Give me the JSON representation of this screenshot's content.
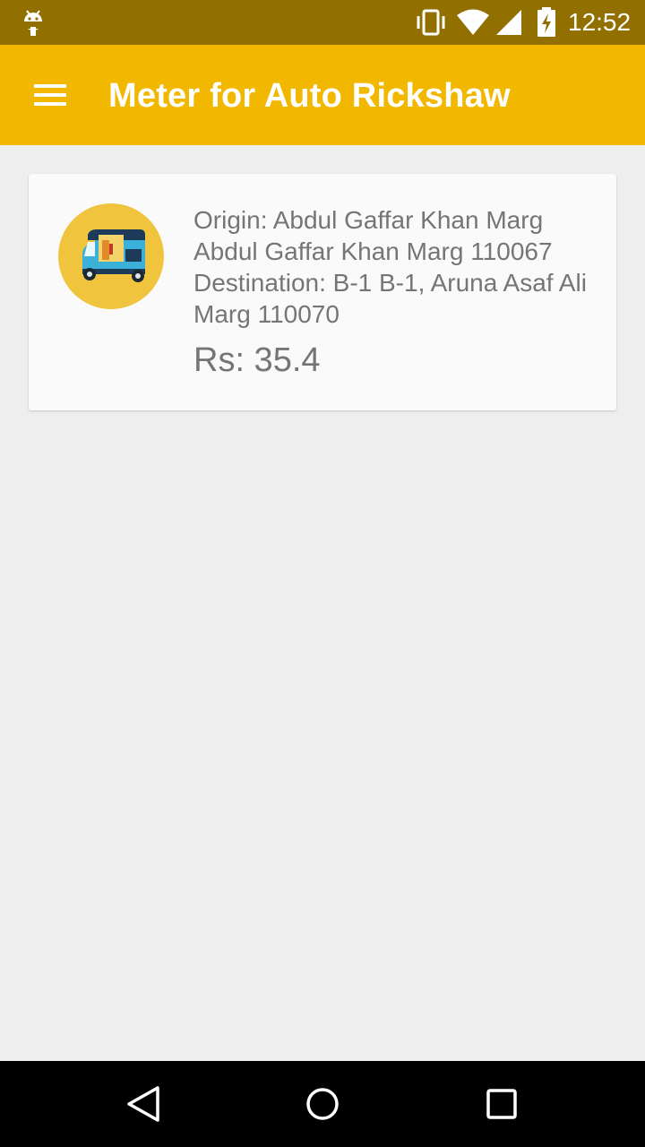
{
  "status_bar": {
    "time": "12:52",
    "icons": [
      "android-icon",
      "vibrate-icon",
      "wifi-icon",
      "signal-icon",
      "battery-charging-icon"
    ]
  },
  "app_bar": {
    "title": "Meter for Auto Rickshaw",
    "menu_icon": "hamburger-menu-icon"
  },
  "trip_card": {
    "image_icon": "auto-rickshaw-icon",
    "origin": "Origin: Abdul Gaffar Khan Marg Abdul Gaffar Khan Marg 110067",
    "destination": "Destination: B-1 B-1, Aruna Asaf Ali Marg 110070",
    "fare": "Rs: 35.4"
  },
  "nav_bar": {
    "icons": [
      "back-icon",
      "home-icon",
      "recents-icon"
    ]
  },
  "colors": {
    "status_bar": "#917000",
    "app_bar": "#f2b800",
    "background": "#eeeeee",
    "card": "#fafafa",
    "text_secondary": "#757575",
    "avatar_circle": "#f0c43c"
  }
}
